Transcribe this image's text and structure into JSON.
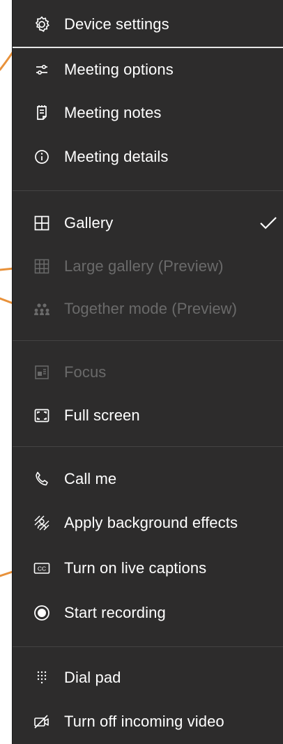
{
  "colors": {
    "menu_bg": "#2d2c2c",
    "text": "#ffffff",
    "disabled_text": "#6a6a6a",
    "annotation_arrow": "#e8913a",
    "separator": "#444343"
  },
  "menu": {
    "sections": [
      {
        "items": [
          {
            "label": "Device settings",
            "icon": "gear-icon",
            "enabled": true
          },
          {
            "label": "Meeting options",
            "icon": "sliders-icon",
            "enabled": true
          },
          {
            "label": "Meeting notes",
            "icon": "notes-icon",
            "enabled": true
          },
          {
            "label": "Meeting details",
            "icon": "info-icon",
            "enabled": true
          }
        ]
      },
      {
        "items": [
          {
            "label": "Gallery",
            "icon": "gallery-icon",
            "enabled": true,
            "selected": true
          },
          {
            "label": "Large gallery (Preview)",
            "icon": "large-gallery-icon",
            "enabled": false
          },
          {
            "label": "Together mode (Preview)",
            "icon": "together-mode-icon",
            "enabled": false
          }
        ]
      },
      {
        "items": [
          {
            "label": "Focus",
            "icon": "focus-icon",
            "enabled": false
          },
          {
            "label": "Full screen",
            "icon": "fullscreen-icon",
            "enabled": true
          }
        ]
      },
      {
        "items": [
          {
            "label": "Call me",
            "icon": "phone-icon",
            "enabled": true
          },
          {
            "label": "Apply background effects",
            "icon": "background-effects-icon",
            "enabled": true
          },
          {
            "label": "Turn on live captions",
            "icon": "cc-icon",
            "enabled": true
          },
          {
            "label": "Start recording",
            "icon": "record-icon",
            "enabled": true
          }
        ]
      },
      {
        "items": [
          {
            "label": "Dial pad",
            "icon": "dialpad-icon",
            "enabled": true
          },
          {
            "label": "Turn off incoming video",
            "icon": "video-off-icon",
            "enabled": true
          }
        ]
      }
    ]
  }
}
